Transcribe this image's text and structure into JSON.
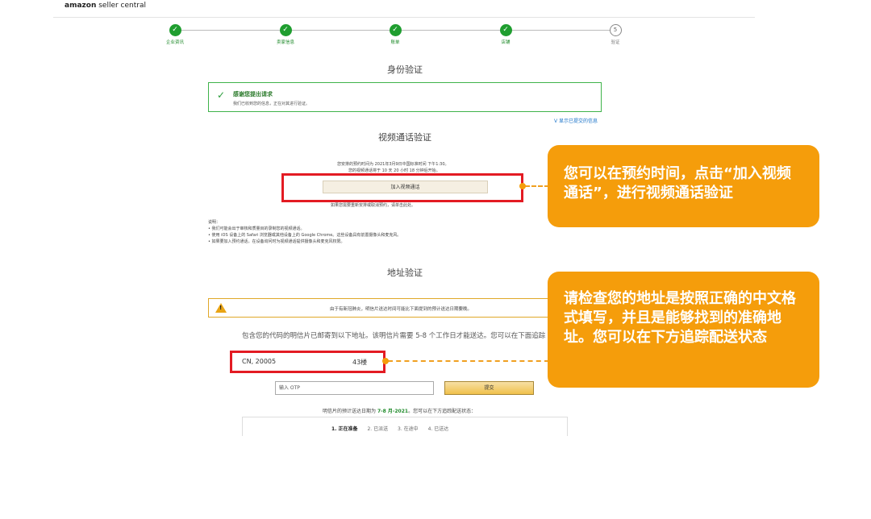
{
  "header": {
    "logo_brand": "amazon",
    "logo_suffix": " seller central"
  },
  "stepper": {
    "steps": [
      {
        "label": "企业资讯",
        "status": "done"
      },
      {
        "label": "卖家信息",
        "status": "done"
      },
      {
        "label": "账单",
        "status": "done"
      },
      {
        "label": "店铺",
        "status": "done"
      },
      {
        "label": "验证",
        "status": "pending",
        "number": "5"
      }
    ],
    "check_glyph": "✓"
  },
  "identity": {
    "title": "身份验证",
    "success_title": "感谢您提出请求",
    "success_text": "我们已收到您的信息，正在对其进行验证。",
    "show_link": "V 显示已提交的信息"
  },
  "video": {
    "title": "视频通话验证",
    "appointment_line": "您安排的预约时间为 2021年3月9日中国标准时间 下午1:30。",
    "start_line": "您的视频通话将于 10 天 20 小时 18 分钟后开始。",
    "join_button": "加入视频通话",
    "reschedule_line": "如果您需要重新安排或取消预约，请单击此处。",
    "notes_title": "说明：",
    "notes": [
      "• 我们可能会出于审核和质量目的录制您的视频通话。",
      "• 使用 iOS 设备上的 Safari 浏览器或其他设备上的 Google Chrome。这些设备具有前置摄像头和麦克风。",
      "• 如果要加入预约通话，在设备询问时为视频通话提供摄像头和麦克风权限。"
    ]
  },
  "address": {
    "title": "地址验证",
    "warning_text": "由于有新冠肺炎，明信片送达时间可能比下面提到的预计送达日期要晚。",
    "description": "包含您的代码的明信片已邮寄到以下地址。该明信片需要 5-8 个工作日才能送达。您可以在下面追踪",
    "address_start": "CN, 20005",
    "address_end": "43楼",
    "otp_placeholder": "输入 OTP",
    "submit_button": "提交",
    "delivery_prefix": "明信片的预计送达日期为",
    "delivery_date": "7-8 月-2021",
    "delivery_suffix": "。您可以在下方追踪配送状态：",
    "tracking_steps": [
      "1. 正在准备",
      "2. 已派送",
      "3. 在途中",
      "4. 已送达"
    ]
  },
  "callouts": {
    "video_tip": "您可以在预约时间，点击“加入视频通话”，进行视频通话验证",
    "address_tip": "请检查您的地址是按照正确的中文格式填写，并且是能够找到的准确地址。您可以在下方追踪配送状态"
  },
  "colors": {
    "callout": "#f59d0b",
    "highlight_frame": "#e31b23",
    "success": "#1f9e2f",
    "link": "#1a73c9"
  }
}
